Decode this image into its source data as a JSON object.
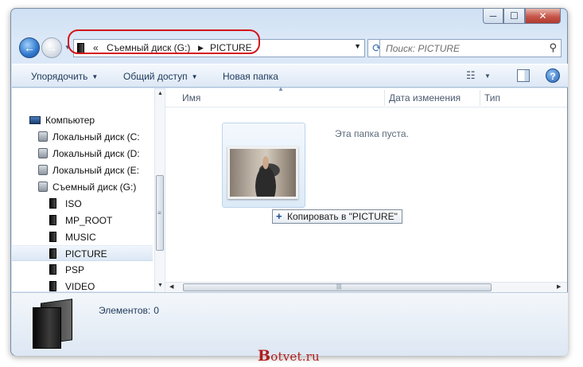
{
  "window": {
    "caption_buttons": {
      "minimize": "─",
      "maximize": "☐",
      "close": "✕"
    }
  },
  "navigation": {
    "back_glyph": "←",
    "forward_glyph": "→",
    "recent_glyph": "▼",
    "address": {
      "overflow": "«",
      "crumbs": [
        "Съемный диск (G:)",
        "PICTURE"
      ],
      "separator": "▶",
      "dropdown_glyph": "▼"
    },
    "refresh_glyph": "⟳",
    "search": {
      "placeholder": "Поиск: PICTURE",
      "icon_glyph": "⚲"
    }
  },
  "toolbar": {
    "organize": "Упорядочить",
    "share": "Общий доступ",
    "new_folder": "Новая папка",
    "dropdown_glyph": "▼",
    "views_glyph": "☷",
    "help_glyph": "?"
  },
  "nav_pane": {
    "items": [
      {
        "label": "Компьютер",
        "icon": "computer-icon",
        "indent": 0
      },
      {
        "label": "Локальный диск (C:",
        "icon": "drive-icon",
        "indent": 1
      },
      {
        "label": "Локальный диск (D:",
        "icon": "drive-icon",
        "indent": 1
      },
      {
        "label": "Локальный диск (E:",
        "icon": "drive-icon",
        "indent": 1
      },
      {
        "label": "Съемный диск (G:)",
        "icon": "drive-icon",
        "indent": 1
      },
      {
        "label": "ISO",
        "icon": "folder-icon",
        "indent": 2
      },
      {
        "label": "MP_ROOT",
        "icon": "folder-icon",
        "indent": 2
      },
      {
        "label": "MUSIC",
        "icon": "folder-icon",
        "indent": 2
      },
      {
        "label": "PICTURE",
        "icon": "folder-icon",
        "indent": 2,
        "selected": true
      },
      {
        "label": "PSP",
        "icon": "folder-icon",
        "indent": 2
      },
      {
        "label": "VIDEO",
        "icon": "folder-icon",
        "indent": 2
      }
    ]
  },
  "content": {
    "columns": [
      "Имя",
      "Дата изменения",
      "Тип"
    ],
    "empty_text": "Эта папка пуста.",
    "drag_tooltip": "Копировать в \"PICTURE\"",
    "drag_tooltip_glyph": "+"
  },
  "scrollbars": {
    "up": "▲",
    "down": "▼",
    "left": "◀",
    "right": "▶",
    "vgrip": "≡",
    "hgrip": "|||"
  },
  "details": {
    "label": "Элементов:",
    "count": "0"
  },
  "watermark": {
    "first": "B",
    "rest": "otvet.ru"
  },
  "colors": {
    "highlight_ring": "#d4141c",
    "accent": "#1e395b"
  }
}
